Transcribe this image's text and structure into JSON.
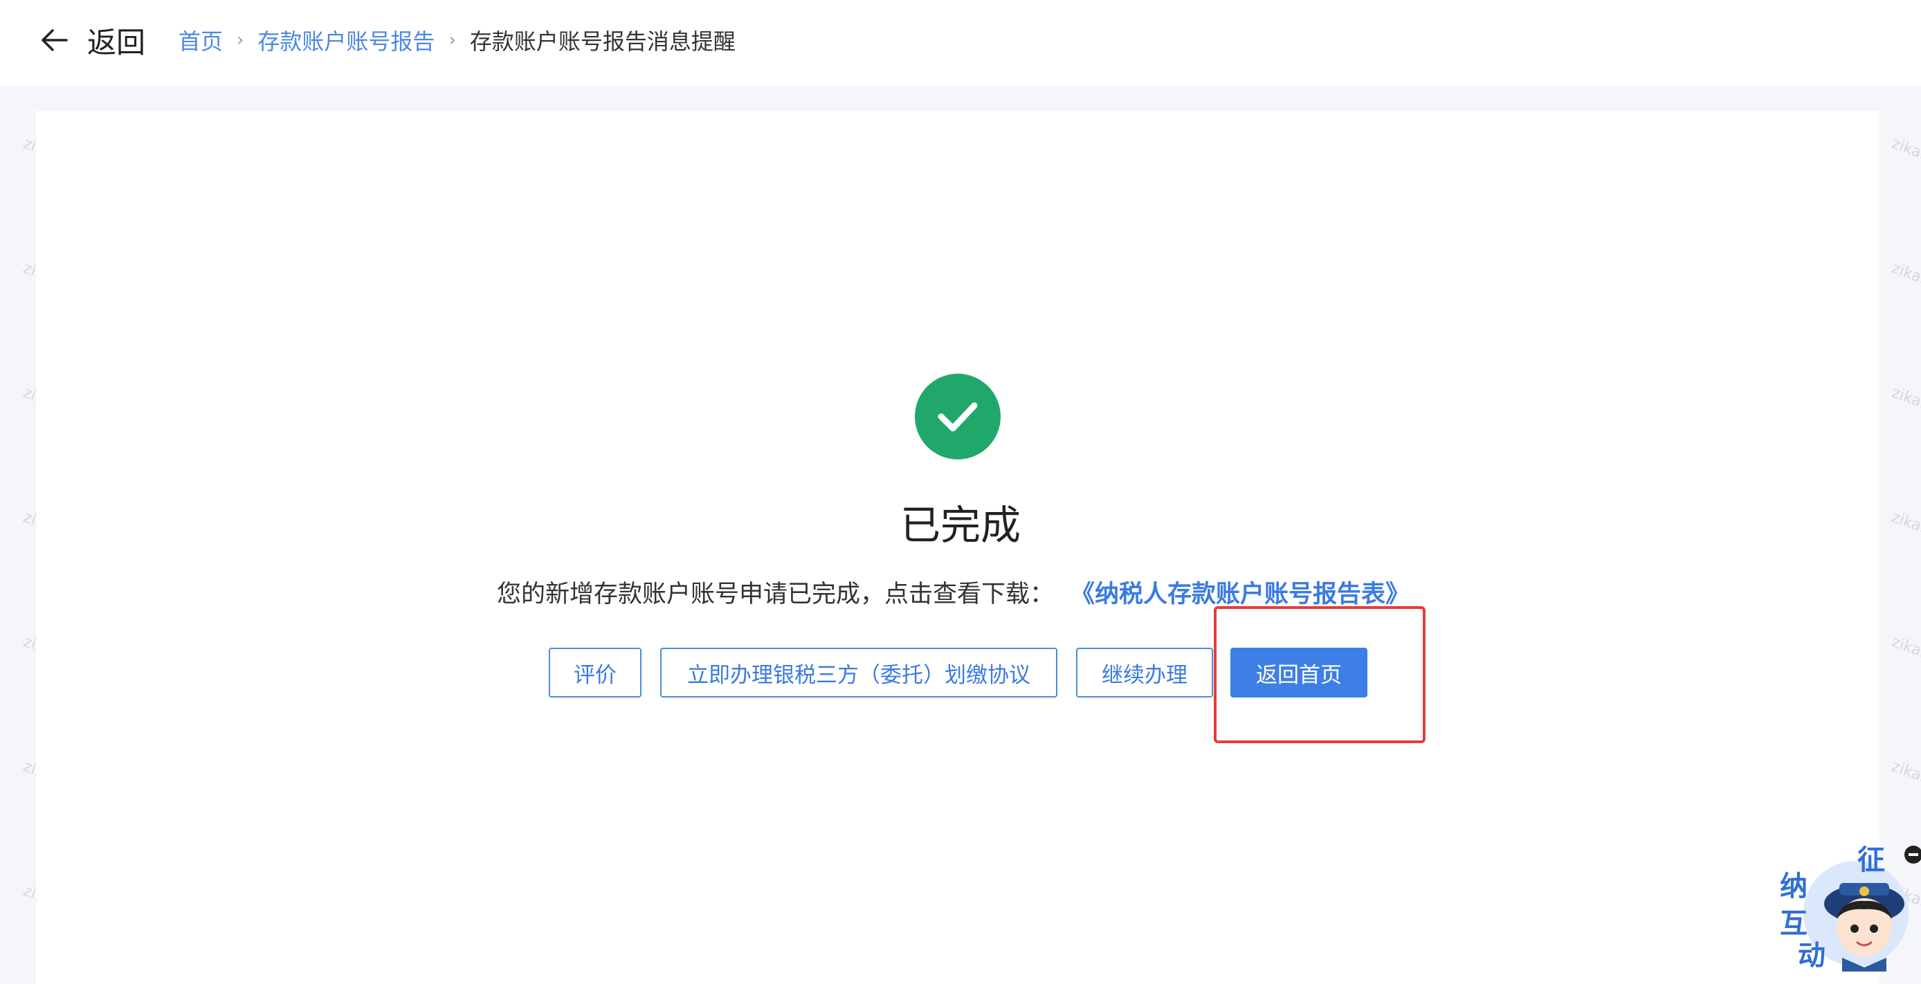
{
  "header": {
    "back_label": "返回",
    "breadcrumb": [
      {
        "label": "首页"
      },
      {
        "label": "存款账户账号报告"
      },
      {
        "label": "存款账户账号报告消息提醒"
      }
    ],
    "separator": "›"
  },
  "result": {
    "status_title": "已完成",
    "message": "您的新增存款账户账号申请已完成，点击查看下载：",
    "download_link": "《纳税人存款账户账号报告表》"
  },
  "actions": {
    "evaluate": "评价",
    "bank_tax_agreement": "立即办理银税三方（委托）划缴协议",
    "continue": "继续办理",
    "return_home": "返回首页"
  },
  "assistant": {
    "chars": [
      "征",
      "纳",
      "互",
      "动"
    ]
  },
  "watermark": "zikaipiao.com",
  "colors": {
    "accent": "#3d7fe6",
    "link": "#4d89e0",
    "success": "#20a86b",
    "highlight": "#e83a3a"
  }
}
